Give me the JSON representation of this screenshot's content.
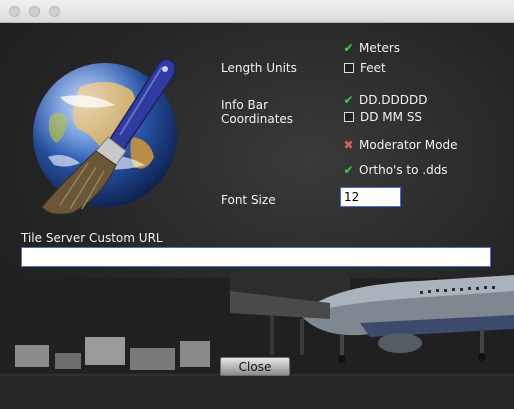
{
  "window": {
    "title": ""
  },
  "settings": {
    "length_units_label": "Length Units",
    "length_units_options": [
      {
        "label": "Meters",
        "state": "checked"
      },
      {
        "label": "Feet",
        "state": "unchecked"
      }
    ],
    "info_bar_label_line1": "Info Bar",
    "info_bar_label_line2": "Coordinates",
    "info_bar_options": [
      {
        "label": "DD.DDDDD",
        "state": "checked"
      },
      {
        "label": "DD MM SS",
        "state": "unchecked"
      }
    ],
    "moderator_mode": {
      "label": "Moderator Mode",
      "state": "crossed"
    },
    "orthos_to_dds": {
      "label": "Ortho's to .dds",
      "state": "checked"
    },
    "font_size_label": "Font Size",
    "font_size_value": "12",
    "tile_server_label": "Tile Server Custom URL",
    "tile_server_value": ""
  },
  "footer": {
    "close_label": "Close"
  },
  "icons": {
    "checked": "checkmark-icon",
    "unchecked": "empty-checkbox-icon",
    "crossed": "x-mark-icon"
  },
  "colors": {
    "check_green": "#3fd13f",
    "cross_red": "#e05a5a",
    "input_border": "#4d6fc0",
    "text": "#f2f2f2"
  }
}
